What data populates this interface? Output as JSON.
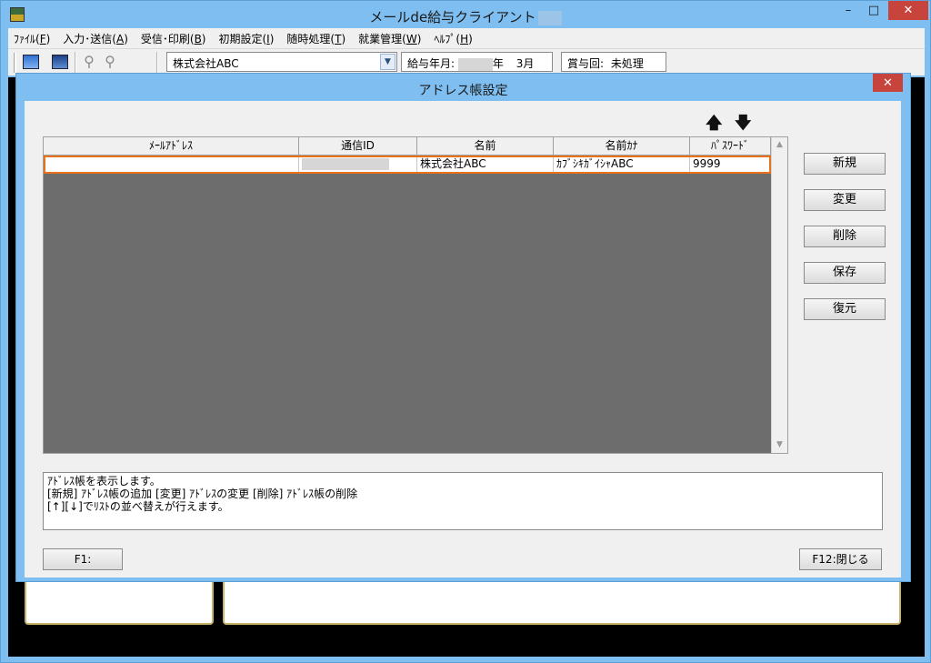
{
  "app": {
    "title": "メールde給与クライアント",
    "window_buttons": {
      "minimize": "–",
      "maximize": "□",
      "close": "✕"
    }
  },
  "menu": [
    {
      "label": "ﾌｧｲﾙ(",
      "key": "F",
      "end": ")"
    },
    {
      "label": "入力･送信(",
      "key": "A",
      "end": ")"
    },
    {
      "label": "受信･印刷(",
      "key": "B",
      "end": ")"
    },
    {
      "label": "初期設定(",
      "key": "I",
      "end": ")"
    },
    {
      "label": "随時処理(",
      "key": "T",
      "end": ")"
    },
    {
      "label": "就業管理(",
      "key": "W",
      "end": ")"
    },
    {
      "label": "ﾍﾙﾌﾟ(",
      "key": "H",
      "end": ")"
    }
  ],
  "toolbar": {
    "company": "株式会社ABC",
    "pay_label": "給与年月:",
    "pay_year_suffix": "年",
    "pay_month": "3月",
    "bonus_label": "賞与回:",
    "bonus_value": "未処理"
  },
  "dialog": {
    "title": "アドレス帳設定",
    "close": "✕",
    "arrow_up": "🡅",
    "arrow_down": "🡇",
    "columns": [
      "ﾒｰﾙｱﾄﾞﾚｽ",
      "通信ID",
      "名前",
      "名前ｶﾅ",
      "ﾊﾟｽﾜｰﾄﾞ"
    ],
    "rows": [
      {
        "email": "",
        "id": "",
        "name": "株式会社ABC",
        "kana": "ｶﾌﾞｼｷｶﾞｲｼｬABC",
        "password": "9999"
      }
    ],
    "buttons": {
      "new": "新規",
      "change": "変更",
      "delete": "削除",
      "save": "保存",
      "restore": "復元"
    },
    "help_lines": [
      "ｱﾄﾞﾚｽ帳を表示します。",
      "[新規] ｱﾄﾞﾚｽ帳の追加 [変更] ｱﾄﾞﾚｽの変更 [削除] ｱﾄﾞﾚｽ帳の削除",
      "[↑][↓]でﾘｽﾄの並べ替えが行えます。"
    ],
    "f1_label": "F1:",
    "f12_label": "F12:閉じる"
  }
}
